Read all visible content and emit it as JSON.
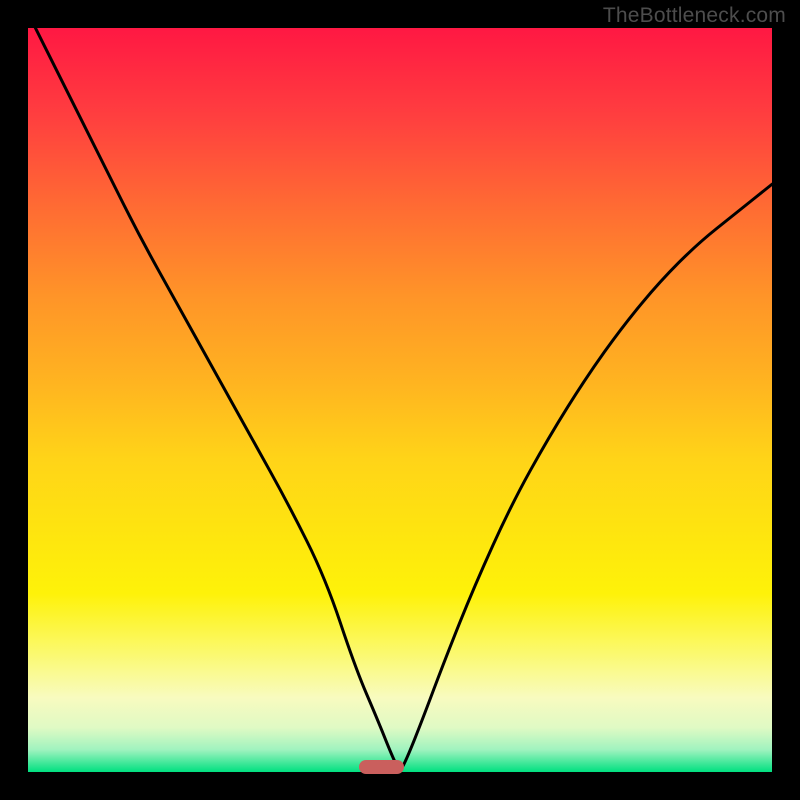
{
  "watermark": "TheBottleneck.com",
  "chart_data": {
    "type": "line",
    "title": "",
    "xlabel": "",
    "ylabel": "",
    "xlim": [
      0,
      100
    ],
    "ylim": [
      0,
      100
    ],
    "series": [
      {
        "name": "bottleneck-curve",
        "x": [
          0,
          5,
          10,
          15,
          20,
          25,
          30,
          35,
          40,
          44,
          47,
          49,
          50,
          51,
          53,
          56,
          60,
          65,
          70,
          75,
          80,
          85,
          90,
          95,
          100
        ],
        "y": [
          102,
          92,
          82,
          72,
          63,
          54,
          45,
          36,
          26,
          14,
          7,
          2,
          0,
          2,
          7,
          15,
          25,
          36,
          45,
          53,
          60,
          66,
          71,
          75,
          79
        ]
      }
    ],
    "marker": {
      "x_center": 47.5,
      "width_pct": 6
    },
    "background_gradient": {
      "top": "#ff1843",
      "mid": "#fee50f",
      "bottom": "#00e080"
    }
  }
}
